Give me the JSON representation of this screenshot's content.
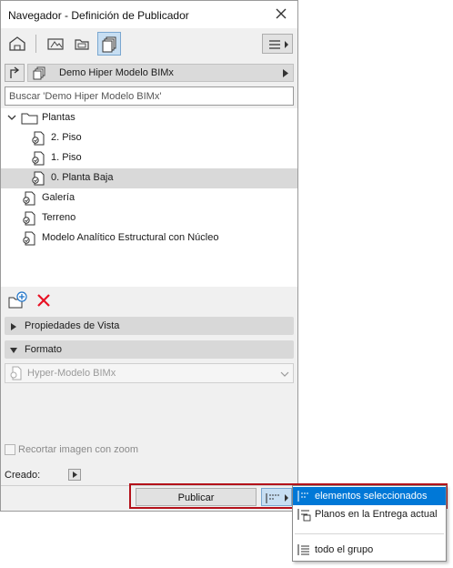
{
  "window": {
    "title": "Navegador - Definición de Publicador"
  },
  "toolbar": {
    "icons": [
      "project-map-icon",
      "view-map-icon",
      "layout-book-icon",
      "publisher-sets-icon"
    ],
    "active": "publisher-sets-icon"
  },
  "project": {
    "name": "Demo Hiper Modelo BIMx"
  },
  "search": {
    "placeholder": "Buscar 'Demo Hiper Modelo BIMx'"
  },
  "tree": {
    "folder": "Plantas",
    "children": [
      "2. Piso",
      "1. Piso",
      "0. Planta Baja"
    ],
    "selected": "0. Planta Baja",
    "items": [
      "Galería",
      "Terreno",
      "Modelo Analítico Estructural con Núcleo"
    ]
  },
  "sections": {
    "view_properties": "Propiedades de Vista",
    "format": "Formato"
  },
  "format": {
    "value": "Hyper-Modelo BIMx"
  },
  "options": {
    "crop_zoom": "Recortar imagen con zoom",
    "created": "Creado:"
  },
  "publish": {
    "label": "Publicar"
  },
  "dropdown": {
    "items": [
      "elementos seleccionados",
      "Planos en la Entrega actual",
      "todo el grupo"
    ],
    "selected": "elementos seleccionados"
  },
  "colors": {
    "accent": "#0078d7",
    "highlight_border": "#b4121b",
    "delete_red": "#e81123",
    "new_folder_blue": "#1e73c8"
  }
}
